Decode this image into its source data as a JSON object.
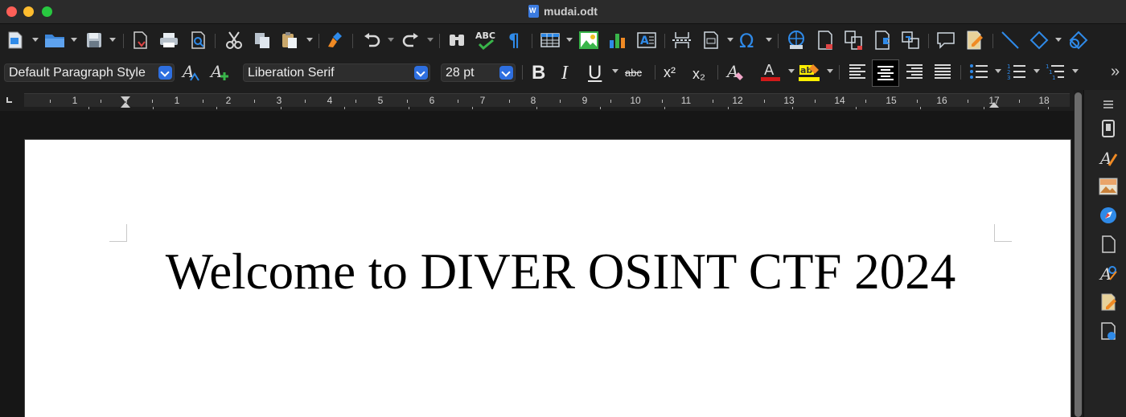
{
  "window": {
    "title": "mudai.odt"
  },
  "format_bar": {
    "paragraph_style": "Default Paragraph Style",
    "font_name": "Liberation Serif",
    "font_size": "28 pt",
    "bold_glyph": "B",
    "italic_glyph": "I",
    "underline_glyph": "U",
    "strikethrough_glyph": "abc",
    "superscript_glyph": "x²",
    "subscript_glyph": "x₂",
    "overflow_glyph": "»"
  },
  "ruler": {
    "labels": [
      "1",
      "1",
      "2",
      "3",
      "4",
      "5",
      "6",
      "7",
      "8",
      "9",
      "10",
      "11",
      "12",
      "13",
      "14",
      "15",
      "16",
      "17",
      "18"
    ]
  },
  "document": {
    "heading": "Welcome to DIVER OSINT CTF 2024"
  },
  "colors": {
    "accent": "#2e6fe0",
    "font_color_bar": "#d11a1a",
    "highlight_bar": "#ffef00",
    "icon_blue": "#2f8ae8",
    "icon_green": "#39b54a"
  },
  "toolbar_icons": [
    "new-document-icon",
    "open-folder-icon",
    "save-icon",
    "export-pdf-icon",
    "print-icon",
    "print-preview-icon",
    "cut-icon",
    "copy-icon",
    "paste-icon",
    "clone-formatting-icon",
    "undo-icon",
    "redo-icon",
    "find-replace-icon",
    "spellcheck-icon",
    "formatting-marks-icon",
    "insert-table-icon",
    "insert-image-icon",
    "insert-chart-icon",
    "insert-textbox-icon",
    "page-break-icon",
    "insert-field-icon",
    "special-character-icon",
    "hyperlink-icon",
    "footnote-icon",
    "endnote-icon",
    "bookmark-icon",
    "cross-reference-icon",
    "comment-icon",
    "track-changes-icon",
    "line-icon",
    "basic-shapes-icon",
    "draw-functions-icon"
  ],
  "sidebar_icons": [
    "sidebar-menu-icon",
    "properties-icon",
    "styles-icon",
    "gallery-icon",
    "navigator-icon",
    "page-icon",
    "style-inspector-icon",
    "manage-changes-icon",
    "design-icon"
  ]
}
